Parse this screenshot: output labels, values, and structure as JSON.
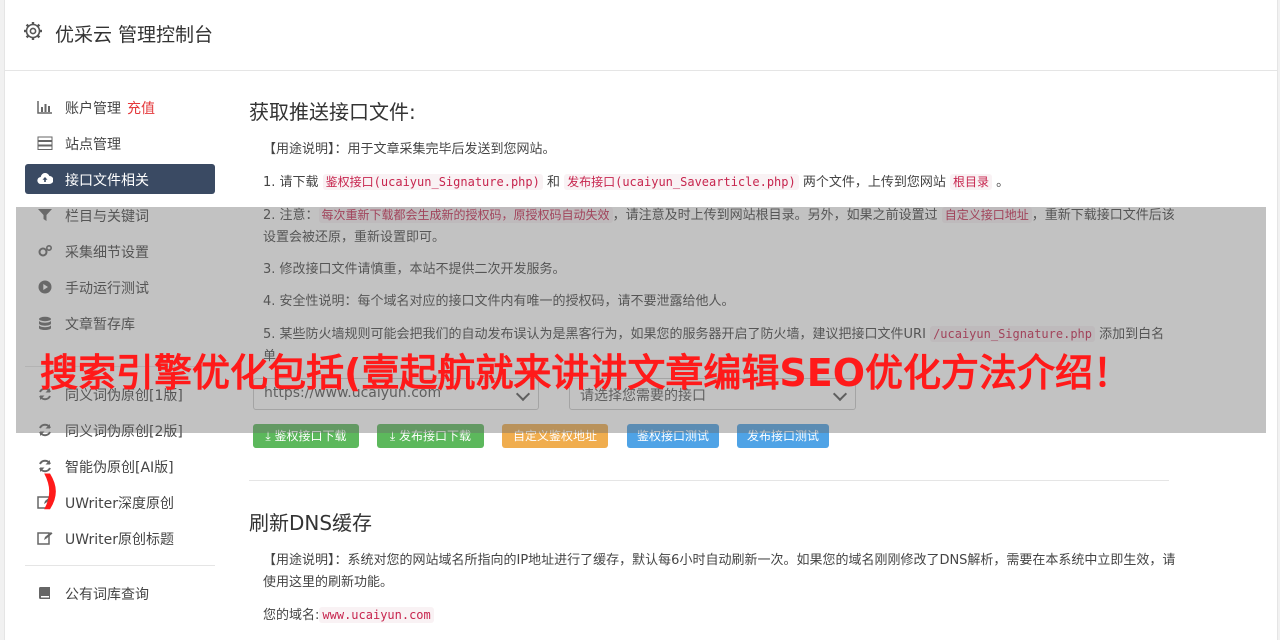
{
  "header": {
    "title": "优采云 管理控制台",
    "icon": "gear-icon"
  },
  "sidebar": {
    "items": [
      {
        "label": "账户管理",
        "tag": "充值",
        "icon": "chart-icon"
      },
      {
        "label": "站点管理",
        "icon": "server-icon"
      },
      {
        "label": "接口文件相关",
        "icon": "cloud-upload-icon",
        "active": true
      },
      {
        "label": "栏目与关键词",
        "icon": "filter-icon"
      },
      {
        "label": "采集细节设置",
        "icon": "cogs-icon"
      },
      {
        "label": "手动运行测试",
        "icon": "play-icon"
      },
      {
        "label": "文章暂存库",
        "icon": "database-icon"
      },
      {
        "label": "同义词伪原创[1版]",
        "icon": "refresh-icon"
      },
      {
        "label": "同义词伪原创[2版]",
        "icon": "refresh-icon"
      },
      {
        "label": "智能伪原创[AI版]",
        "icon": "refresh-icon"
      },
      {
        "label": "UWriter深度原创",
        "icon": "edit-icon"
      },
      {
        "label": "UWriter原创标题",
        "icon": "edit-icon"
      },
      {
        "label": "公有词库查询",
        "icon": "book-icon"
      }
    ]
  },
  "section1": {
    "title": "获取推送接口文件:",
    "usage": "【用途说明】：用于文章采集完毕后发送到您网站。",
    "item1": {
      "a": "1. 请下载 ",
      "code1": "鉴权接口(ucaiyun_Signature.php)",
      "b": " 和 ",
      "code2": "发布接口(ucaiyun_Savearticle.php)",
      "c": " 两个文件，上传到您网站 ",
      "code3": "根目录",
      "d": " 。"
    },
    "item2": {
      "a": "2. 注意：",
      "code1": "每次重新下载都会生成新的授权码，原授权码自动失效",
      "b": "，请注意及时上传到网站根目录。另外，如果之前设置过 ",
      "code2": "自定义接口地址",
      "c": "，重新下载接口文件后该设置会被还原，重新设置即可。"
    },
    "item3": "3. 修改接口文件请慎重，本站不提供二次开发服务。",
    "item4": "4. 安全性说明：每个域名对应的接口文件内有唯一的授权码，请不要泄露给他人。",
    "item5": {
      "a": "5. 某些防火墙规则可能会把我们的自动发布误认为是黑客行为，如果您的服务器开启了防火墙，建议把接口文件URI ",
      "code1": "/ucaiyun_Signature.php",
      "b": " 添加到白名单。"
    },
    "select_site": "https://www.ucaiyun.com",
    "select_api": "请选择您需要的接口",
    "buttons": [
      "鉴权接口下载",
      "发布接口下载",
      "自定义鉴权地址",
      "鉴权接口测试",
      "发布接口测试"
    ]
  },
  "section2": {
    "title": "刷新DNS缓存",
    "usage": "【用途说明】：系统对您的网站域名所指向的IP地址进行了缓存，默认每6小时自动刷新一次。如果您的域名刚刚修改了DNS解析，需要在本系统中立即生效，请使用这里的刷新功能。",
    "domain_label": "您的域名:",
    "domain_value": "www.ucaiyun.com"
  },
  "overlay": {
    "banner": "搜索引擎优化包括(壹起航就来讲讲文章编辑SEO优化方法介绍！",
    "paren": ")"
  }
}
